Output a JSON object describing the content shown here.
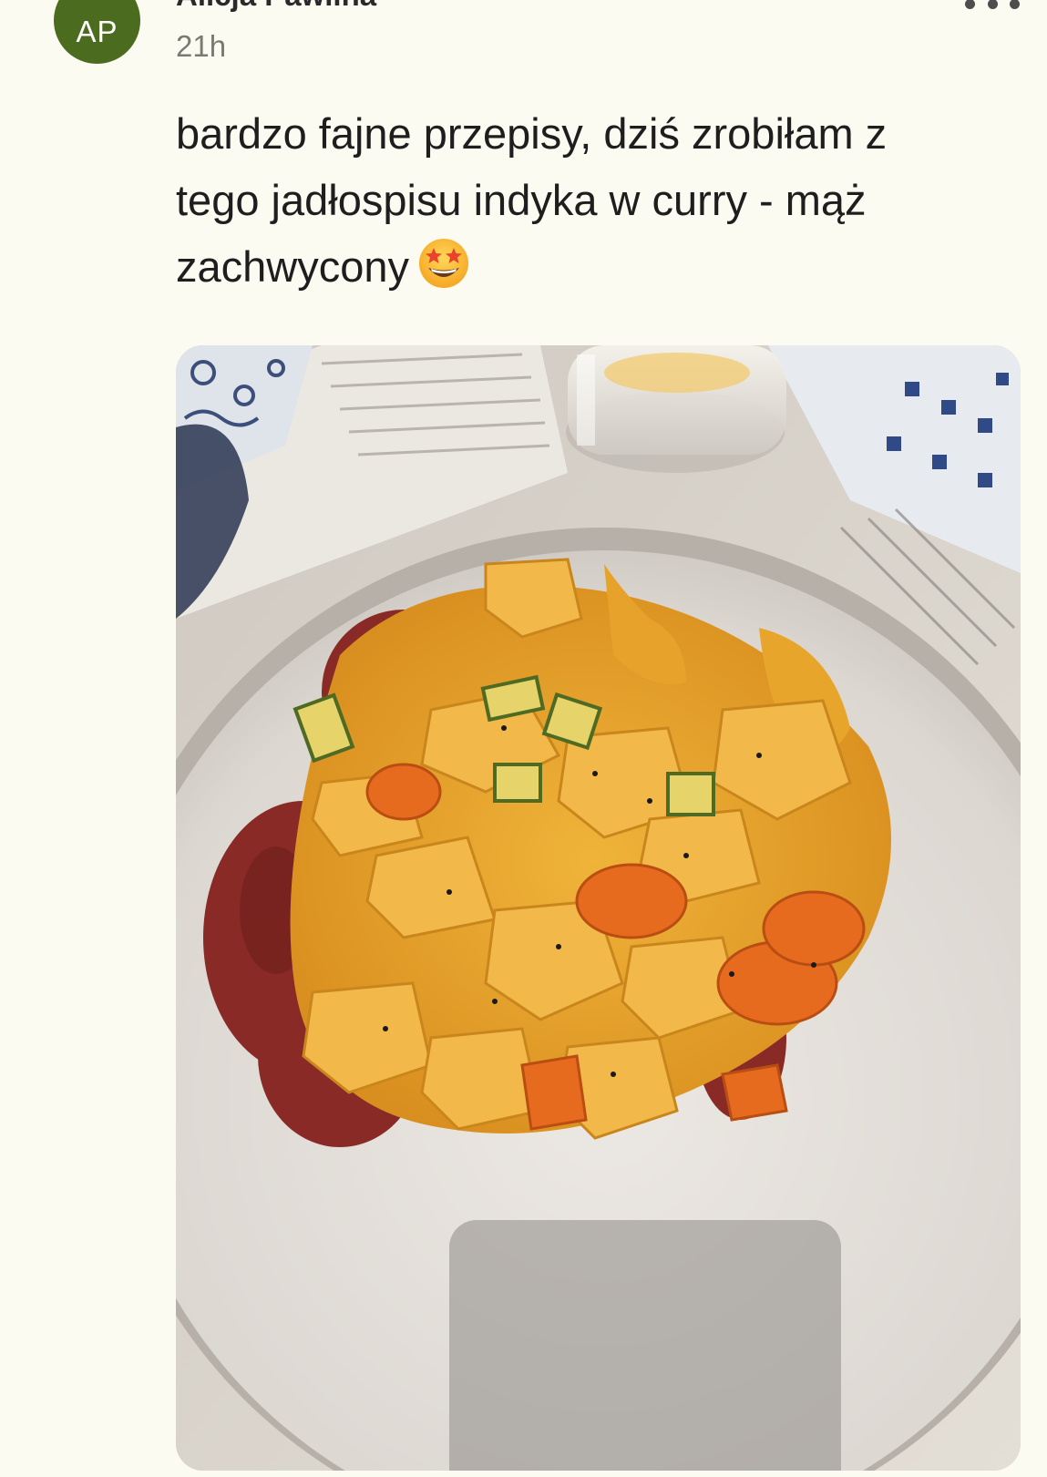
{
  "post": {
    "author": {
      "initials": "AP",
      "name": "Alicja Pawlina",
      "avatar_color": "#4b6b1f"
    },
    "timestamp": "21h",
    "more_icon": "more-horizontal-icon",
    "text": "bardzo fajne przepisy, dziś zrobiłam z tego jadłospisu indyka w curry - mąż zachwycony",
    "emoji": "star-struck-emoji",
    "photo": {
      "subject": "curry-dish-photo"
    }
  },
  "colors": {
    "background": "#fcfbf1",
    "text": "#1e1e1e",
    "muted": "#7a7a72"
  }
}
